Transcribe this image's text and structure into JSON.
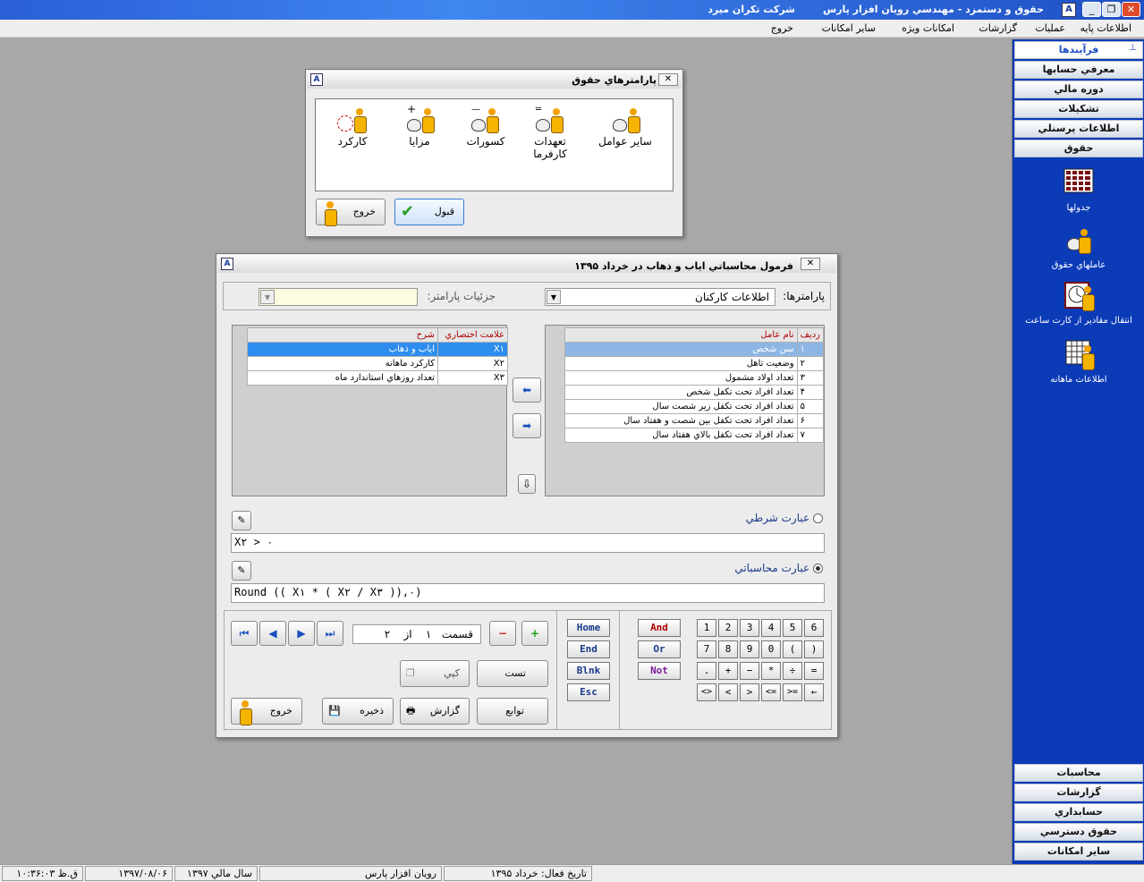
{
  "titlebar": {
    "title": "حقوق و دستمزد - مهندسي رويان افزار پارس",
    "company": "شركت تكران ميرد"
  },
  "menu": [
    "اطلاعات پايه",
    "عمليات",
    "گزارشات",
    "امكانات ويژه",
    "ساير امكانات",
    "خروج"
  ],
  "sidebar": {
    "header": "فرآيندها",
    "top_items": [
      "معرفي حسابها",
      "دوره مالي",
      "تشكيلات",
      "اطلاعات پرسنلي",
      "حقوق"
    ],
    "tools": [
      {
        "label": "جدولها",
        "icon": "grid-icon"
      },
      {
        "label": "عاملهاي حقوق",
        "icon": "person-money-icon"
      },
      {
        "label": "انتقال مقادير از كارت ساعت",
        "icon": "timecard-icon"
      },
      {
        "label": "اطلاعات ماهانه",
        "icon": "calendar-grid-icon"
      }
    ],
    "bottom_items": [
      "محاسبات",
      "گزارشات",
      "حسابداري",
      "حقوق دسترسي",
      "ساير امكانات"
    ]
  },
  "dialog1": {
    "title": "پارامترهاي حقوق",
    "icons": [
      "سایر عوامل",
      "تعهدات كارفرما",
      "كسورات",
      "مزايا",
      "كاركرد"
    ],
    "ok": "قبول",
    "exit": "خروج"
  },
  "dialog2": {
    "title": "فرمول محاسباتي اياب و ذهاب در خرداد ۱۳۹۵",
    "params_label": "پارامترها:",
    "params_value": "اطلاعات كاركنان",
    "details_label": "جزئيات پارامتر:",
    "right_table": {
      "headers": [
        "رديف",
        "نام عامل"
      ],
      "rows": [
        [
          "۱",
          "سن شخص"
        ],
        [
          "۲",
          "وضعيت تاهل"
        ],
        [
          "۳",
          "تعداد اولاد مشمول"
        ],
        [
          "۴",
          "تعداد افراد تحت تكفل شخص"
        ],
        [
          "۵",
          "تعداد افراد تحت تكفل زير شصت سال"
        ],
        [
          "۶",
          "تعداد افراد تحت تكفل بين شصت و هفتاد سال"
        ],
        [
          "۷",
          "تعداد افراد تحت تكفل بالاي هفتاد سال"
        ]
      ]
    },
    "left_table": {
      "headers": [
        "علامت اختصاري",
        "شرح"
      ],
      "rows": [
        [
          "X۱",
          "اياب و ذهاب"
        ],
        [
          "X۲",
          "كاركرد ماهانه"
        ],
        [
          "X۳",
          "تعداد روزهاي استاندارد ماه"
        ]
      ]
    },
    "condition_label": "عبارت شرطي",
    "condition_value": "X۲ > ۰",
    "calc_label": "عبارت محاسباتي",
    "calc_value": "Round (( X۱ * ( X۲ / X۳ )),۰)",
    "section": {
      "label": "قسمت",
      "current": "۱",
      "of": "از",
      "total": "۲"
    },
    "buttons": {
      "test": "تست",
      "copy": "كپي",
      "functions": "توابع",
      "report": "گزارش",
      "save": "ذخيره",
      "exit": "خروج"
    },
    "keys_nav": [
      "Home",
      "End",
      "Blnk",
      "Esc"
    ],
    "keys_logic": [
      "And",
      "Or",
      "Not"
    ],
    "keys_row1": [
      "1",
      "2",
      "3",
      "4",
      "5",
      "6"
    ],
    "keys_row2": [
      "7",
      "8",
      "9",
      "0",
      "(",
      ")"
    ],
    "keys_row3": [
      ".",
      "+",
      "−",
      "*",
      "÷",
      "="
    ],
    "keys_row4": [
      "<>",
      "<",
      ">",
      "<=",
      ">=",
      "←"
    ]
  },
  "status": {
    "active_date_label": "تاريخ فعال:",
    "active_date": "خرداد ۱۳۹۵",
    "company": "رويان افزار پارس",
    "fiscal": "سال مالي ۱۳۹۷",
    "date": "۱۳۹۷/۰۸/۰۶",
    "time": "ق.ظ ۱۰:۳۶:۰۳"
  }
}
